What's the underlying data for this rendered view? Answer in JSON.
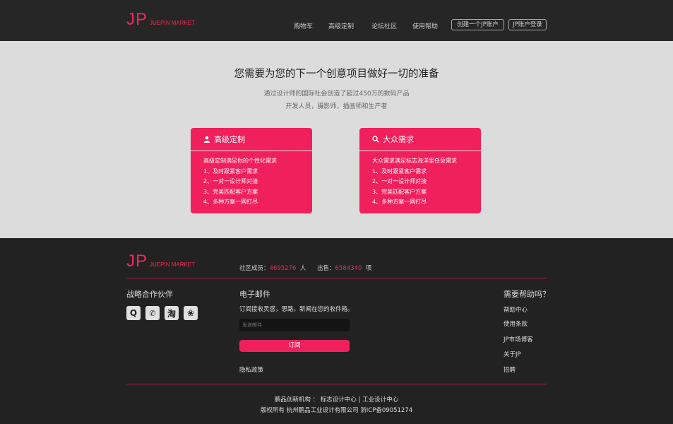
{
  "header": {
    "logo_mark": "JP",
    "logo_text": "JUEPIN MARKET",
    "nav": [
      "购物车",
      "高级定制",
      "论坛社区",
      "使用帮助"
    ],
    "create_account": "创建一个JP账户",
    "login": "JP账户登录"
  },
  "hero": {
    "title": "您需要为您的下一个创意项目做好一切的准备",
    "subtitle1": "通过设计师的国际社会创造了超过450万的数码产品",
    "subtitle2": "开发人员，摄影师，插画师和生产者",
    "cards": [
      {
        "icon": "user-icon",
        "title": "高级定制",
        "lines": [
          "高级定制满足你的个性化需求",
          "1、及时跟紧客户需求",
          "2、一对一设计师对接",
          "3、完美匹配客户方案",
          "4、多种方案一网打尽"
        ]
      },
      {
        "icon": "search-icon",
        "title": "大众需求",
        "lines": [
          "大众需求满足标志海洋里任意需求",
          "1、及时跟紧客户需求",
          "2、一对一设计师对接",
          "3、完美匹配客户方案",
          "4、多种方案一网打尽"
        ]
      }
    ]
  },
  "footer": {
    "logo_mark": "JP",
    "logo_text": "JUEPIN MARKET",
    "members_label": "社区成员：",
    "members_value": "4695276",
    "members_unit": "人",
    "sold_label": "出售：",
    "sold_value": "6584340",
    "sold_unit": "项",
    "partners_title": "战略合作伙伴",
    "partners_icons": [
      "qq-icon",
      "wechat-icon",
      "taobao-icon",
      "baidu-icon"
    ],
    "partners_glyphs": [
      "Q",
      "✆",
      "淘",
      "❀"
    ],
    "email_title": "电子邮件",
    "email_desc": "订阅接收灵感，思路，新闻在您的收件箱。",
    "email_placeholder": "发送邮件",
    "subscribe": "订阅",
    "privacy": "隐私政策",
    "help_title": "需要帮助吗？",
    "help_links": [
      "帮助中心",
      "使用条款",
      "JP市场博客",
      "关于JP",
      "招聘"
    ],
    "copy_line1": "鹏品创新机构 ： 标志设计中心 | 工业设计中心",
    "copy_line2": "版权所有 杭州鹏品工业设计有限公司 浙ICP备09051274"
  },
  "colors": {
    "accent": "#f0205d",
    "header_bg": "#262626",
    "hero_bg": "#dcdcdc",
    "footer_bg": "#222222"
  }
}
